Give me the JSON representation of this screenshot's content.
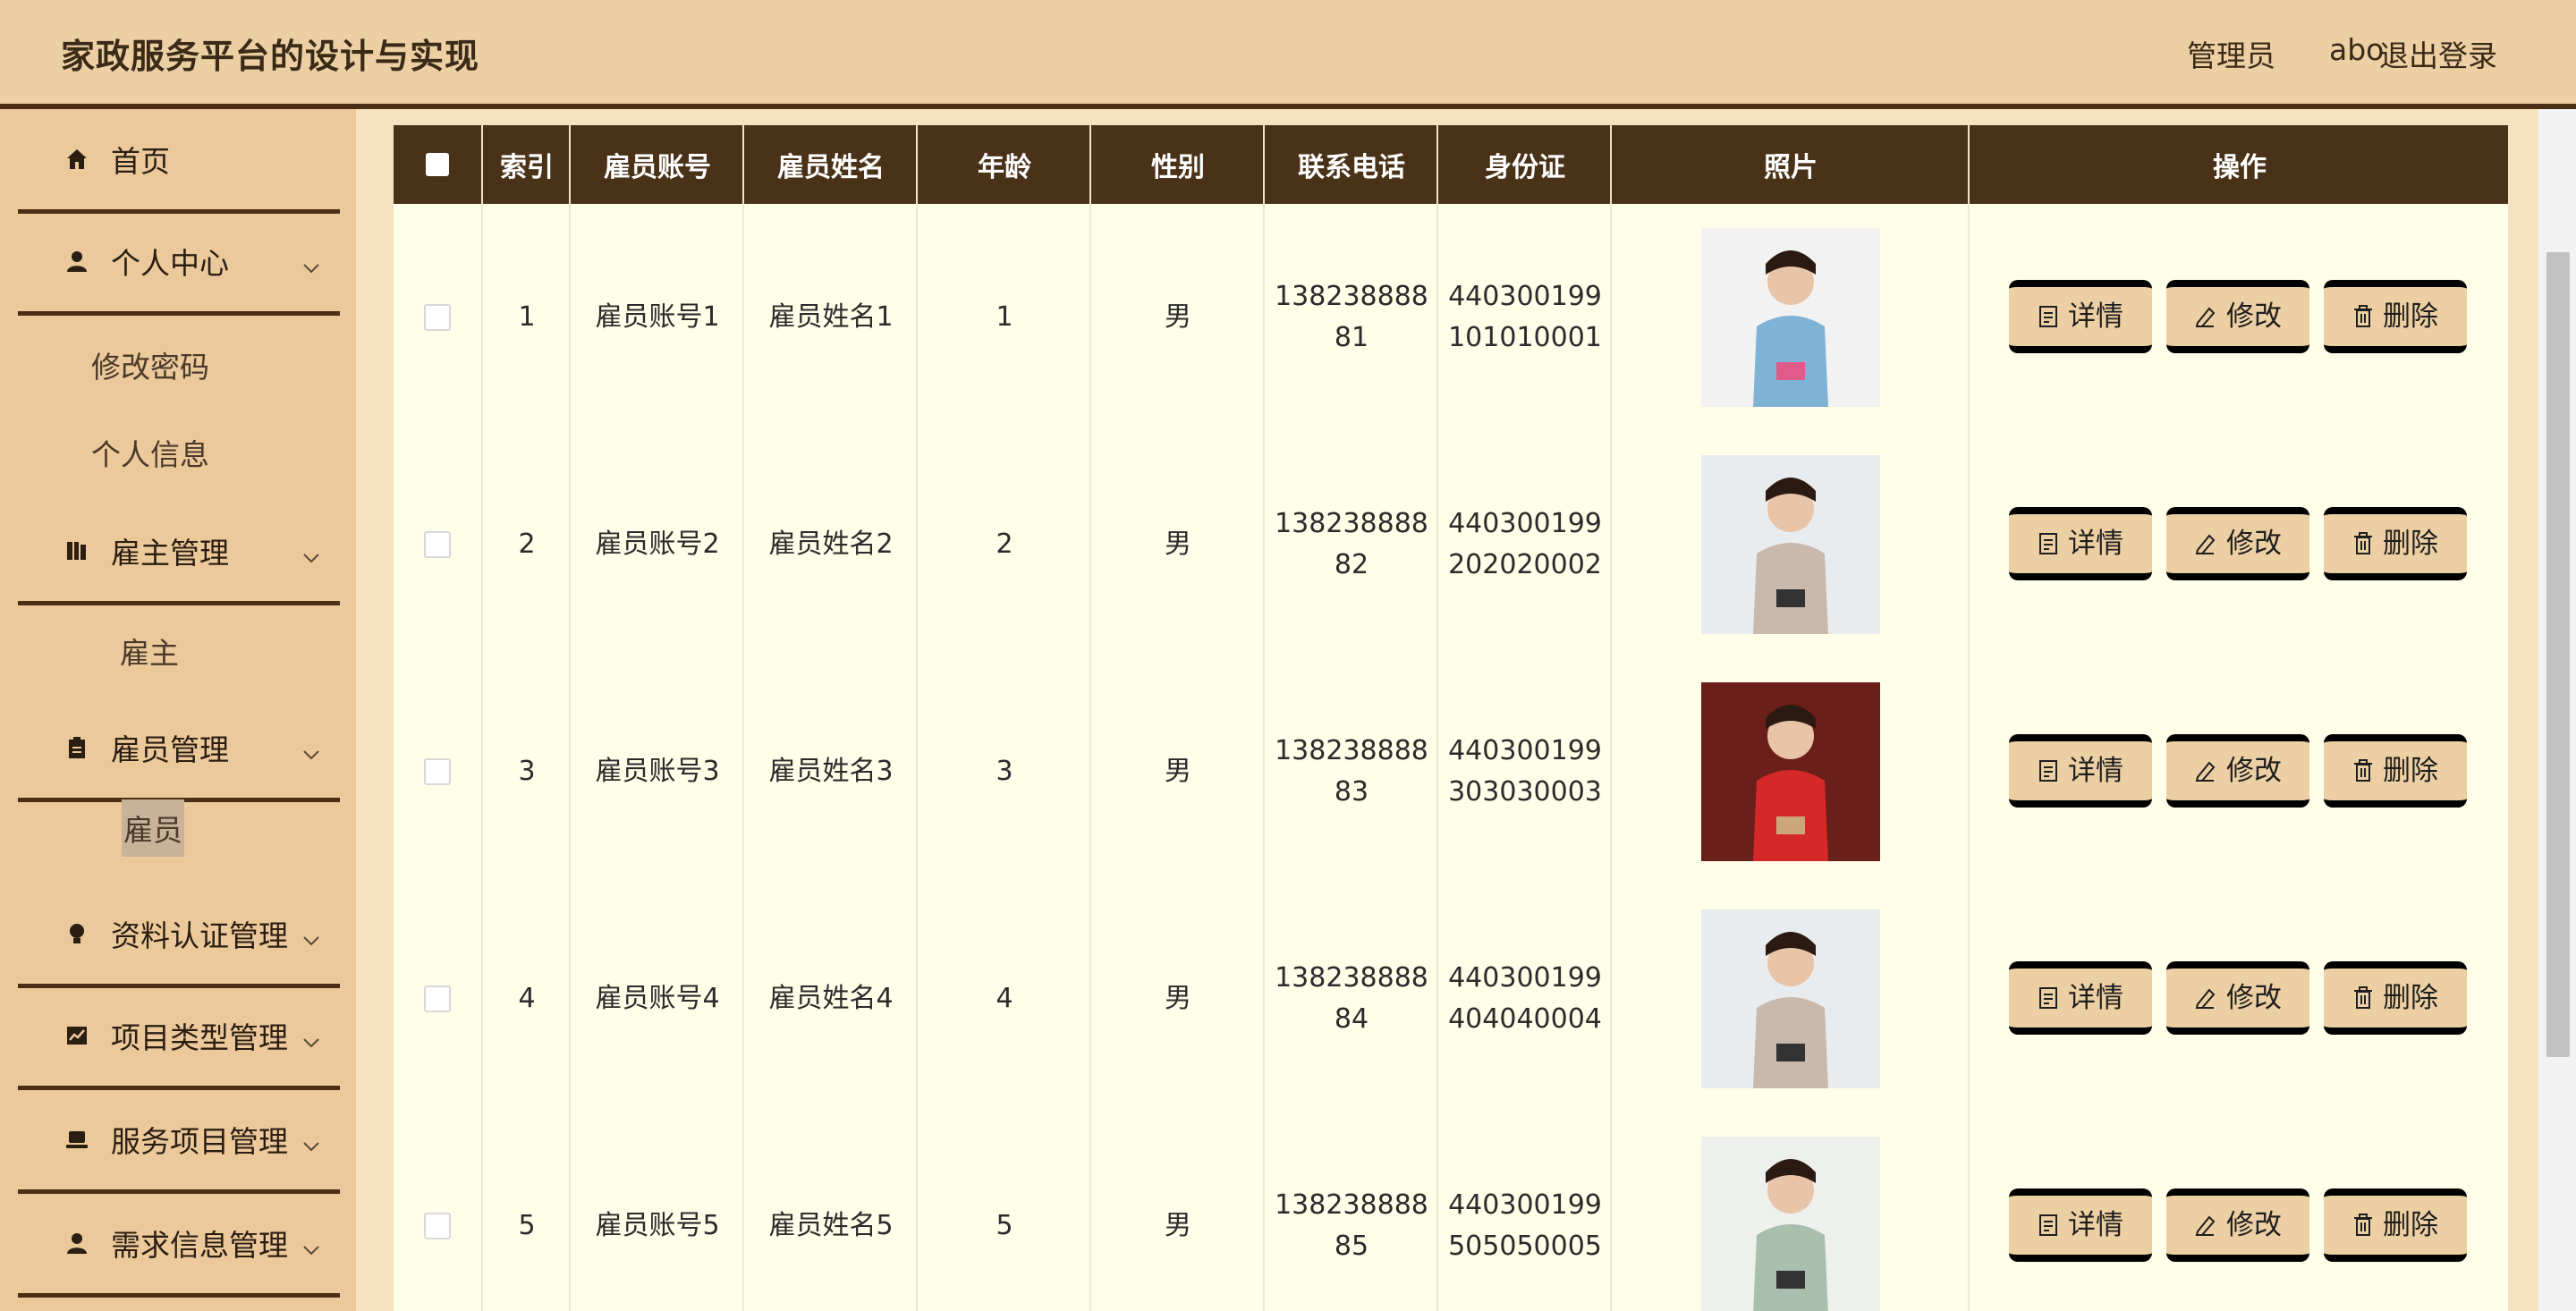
{
  "header": {
    "title": "家政服务平台的设计与实现",
    "user_role": "管理员",
    "user_name": "abo",
    "logout": "退出登录"
  },
  "sidebar": {
    "items": [
      {
        "label": "首页",
        "icon": "home-icon"
      },
      {
        "label": "个人中心",
        "icon": "user-icon"
      },
      {
        "label": "雇主管理",
        "icon": "books-icon"
      },
      {
        "label": "雇员管理",
        "icon": "clipboard-icon"
      },
      {
        "label": "资料认证管理",
        "icon": "bulb-icon"
      },
      {
        "label": "项目类型管理",
        "icon": "chart-icon"
      },
      {
        "label": "服务项目管理",
        "icon": "laptop-icon"
      },
      {
        "label": "需求信息管理",
        "icon": "user-icon"
      }
    ],
    "subitems": {
      "personal": [
        "修改密码",
        "个人信息"
      ],
      "employer": [
        "雇主"
      ],
      "employee": [
        "雇员"
      ]
    }
  },
  "table": {
    "headers": [
      "索引",
      "雇员账号",
      "雇员姓名",
      "年龄",
      "性别",
      "联系电话",
      "身份证",
      "照片",
      "操作"
    ],
    "rows": [
      {
        "index": "1",
        "account": "雇员账号1",
        "name": "雇员姓名1",
        "age": "1",
        "gender": "男",
        "phone_1": "138238888",
        "phone_2": "81",
        "id_1": "440300199",
        "id_2": "101010001"
      },
      {
        "index": "2",
        "account": "雇员账号2",
        "name": "雇员姓名2",
        "age": "2",
        "gender": "男",
        "phone_1": "138238888",
        "phone_2": "82",
        "id_1": "440300199",
        "id_2": "202020002"
      },
      {
        "index": "3",
        "account": "雇员账号3",
        "name": "雇员姓名3",
        "age": "3",
        "gender": "男",
        "phone_1": "138238888",
        "phone_2": "83",
        "id_1": "440300199",
        "id_2": "303030003"
      },
      {
        "index": "4",
        "account": "雇员账号4",
        "name": "雇员姓名4",
        "age": "4",
        "gender": "男",
        "phone_1": "138238888",
        "phone_2": "84",
        "id_1": "440300199",
        "id_2": "404040004"
      },
      {
        "index": "5",
        "account": "雇员账号5",
        "name": "雇员姓名5",
        "age": "5",
        "gender": "男",
        "phone_1": "138238888",
        "phone_2": "85",
        "id_1": "440300199",
        "id_2": "505050005"
      }
    ],
    "actions": {
      "detail": "详情",
      "edit": "修改",
      "delete": "删除"
    }
  },
  "colors": {
    "header_bg": "#eccfa3",
    "sidebar_bg": "#ecc99b",
    "table_head": "#4a3218",
    "row_bg": "#fffee9",
    "button_bg": "#eccfa3"
  }
}
